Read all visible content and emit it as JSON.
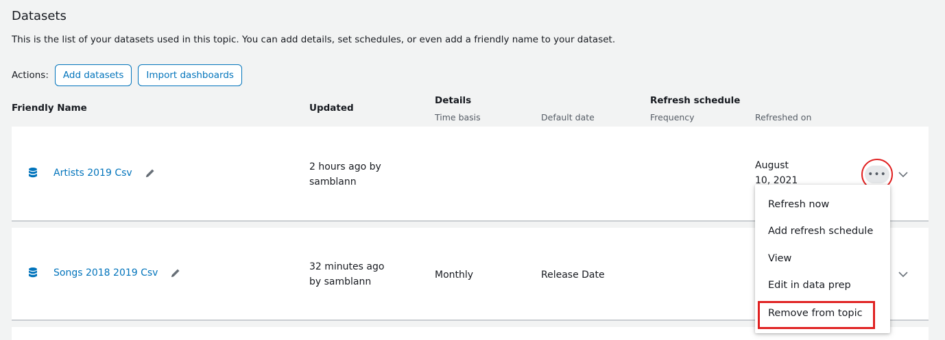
{
  "page": {
    "title": "Datasets",
    "description": "This is the list of your datasets used in this topic. You can add details, set schedules, or even add a friendly name to your dataset."
  },
  "actions": {
    "label": "Actions:",
    "add_datasets": "Add datasets",
    "import_dashboards": "Import dashboards"
  },
  "table": {
    "headers": {
      "friendly_name": "Friendly Name",
      "updated": "Updated",
      "details": "Details",
      "time_basis": "Time basis",
      "default_date": "Default date",
      "refresh_schedule": "Refresh schedule",
      "frequency": "Frequency",
      "refreshed_on": "Refreshed on"
    },
    "rows": [
      {
        "name": "Artists 2019 Csv",
        "updated_line1": "2 hours ago by",
        "updated_line2": "samblann",
        "time_basis": "",
        "default_date": "",
        "frequency": "",
        "refreshed_line1": "August",
        "refreshed_line2": "10, 2021"
      },
      {
        "name": "Songs 2018 2019 Csv",
        "updated_line1": "32 minutes ago",
        "updated_line2": "by samblann",
        "time_basis": "Monthly",
        "default_date": "Release Date",
        "frequency": "",
        "refreshed_line1": "",
        "refreshed_line2": ""
      }
    ]
  },
  "menu": {
    "items": [
      "Refresh now",
      "Add refresh schedule",
      "View",
      "Edit in data prep",
      "Remove from topic"
    ]
  },
  "icons": {
    "dataset": "database-icon",
    "edit": "pencil-icon",
    "more": "more-actions-icon",
    "expand": "chevron-down-icon"
  },
  "colors": {
    "link": "#0073bb",
    "highlight": "#e02020",
    "background": "#f2f3f3"
  }
}
